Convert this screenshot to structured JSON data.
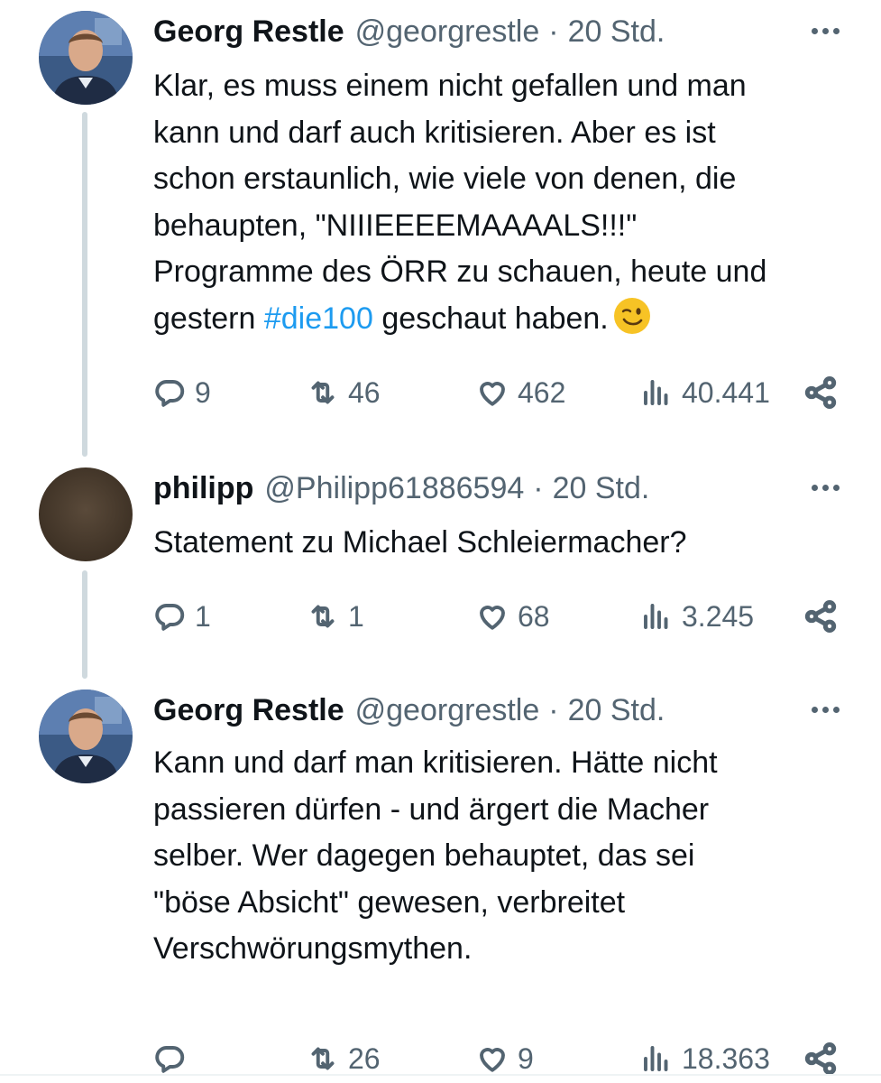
{
  "accent_color": "#1d9bf0",
  "tweets": [
    {
      "name": "Georg Restle",
      "handle": "@georgrestle",
      "separator": "·",
      "time": "20 Std.",
      "text_before": "Klar, es muss einem nicht gefallen und man\nkann und darf auch kritisieren. Aber es ist\nschon erstaunlich, wie viele von denen, die\nbehaupten, \"NIIIEEEEMAAAALS!!!\"\nProgramme des ÖRR zu schauen, heute und\ngestern ",
      "hashtag": "#die100",
      "text_after": " geschaut haben.",
      "emoji": "winking-face-emoji",
      "replies": "9",
      "retweets": "46",
      "likes": "462",
      "views": "40.441"
    },
    {
      "name": "philipp",
      "handle": "@Philipp61886594",
      "separator": "·",
      "time": "20 Std.",
      "text": "Statement zu Michael Schleiermacher?",
      "replies": "1",
      "retweets": "1",
      "likes": "68",
      "views": "3.245"
    },
    {
      "name": "Georg Restle",
      "handle": "@georgrestle",
      "separator": "·",
      "time": "20 Std.",
      "text": "Kann und darf man kritisieren. Hätte nicht\npassieren dürfen - und ärgert die Macher\nselber. Wer dagegen behauptet, das sei\n\"böse Absicht\" gewesen, verbreitet\nVerschwörungsmythen.",
      "replies": "",
      "retweets": "26",
      "likes": "9",
      "views": "18.363"
    }
  ]
}
